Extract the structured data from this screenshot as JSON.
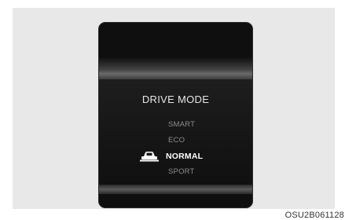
{
  "display": {
    "title": "DRIVE MODE",
    "modes": [
      {
        "label": "SMART",
        "selected": false
      },
      {
        "label": "ECO",
        "selected": false
      },
      {
        "label": "NORMAL",
        "selected": true
      },
      {
        "label": "SPORT",
        "selected": false
      }
    ],
    "selected_icon": "car-icon"
  },
  "caption": "OSU2B061128"
}
